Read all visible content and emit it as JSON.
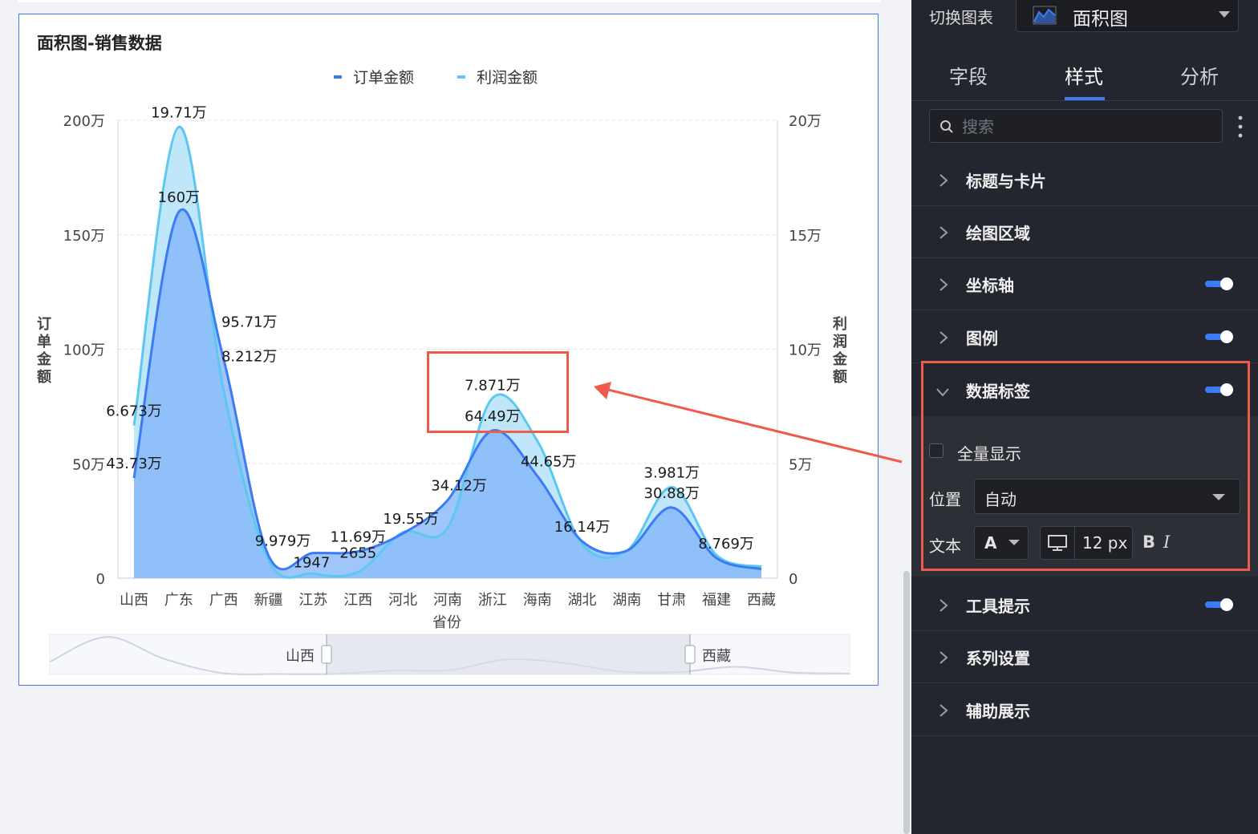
{
  "chart_card": {
    "title": "面积图-销售数据"
  },
  "chart_data": {
    "type": "area",
    "title": "面积图-销售数据",
    "xlabel": "省份",
    "ylabel_left": "订单金额",
    "ylabel_right": "利润金额",
    "categories": [
      "山西",
      "广东",
      "广西",
      "新疆",
      "江苏",
      "江西",
      "河北",
      "河南",
      "浙江",
      "海南",
      "湖北",
      "湖南",
      "甘肃",
      "福建",
      "西藏"
    ],
    "ylim_left": [
      0,
      2000000
    ],
    "ylim_right": [
      0,
      200000
    ],
    "yticks_left": [
      "0",
      "50万",
      "100万",
      "150万",
      "200万"
    ],
    "yticks_right": [
      "0",
      "5万",
      "10万",
      "15万",
      "20万"
    ],
    "grid": true,
    "legend": "top-center",
    "series": [
      {
        "name": "订单金额",
        "axis": "left",
        "color": "#3d7bf5",
        "values": [
          437300,
          1600000,
          957100,
          99790,
          110000,
          116900,
          195500,
          341200,
          644900,
          446500,
          161400,
          120000,
          308800,
          87690,
          40000
        ],
        "labels": [
          "43.73万",
          "160万",
          "95.71万",
          "9.979万",
          "",
          "11.69万",
          "19.55万",
          "34.12万",
          "64.49万",
          "44.65万",
          "16.14万",
          "",
          "30.88万",
          "8.769万",
          ""
        ]
      },
      {
        "name": "利润金额",
        "axis": "right",
        "color": "#5cc8f0",
        "values": [
          66730,
          197100,
          82120,
          8000,
          1947,
          2655,
          20000,
          22000,
          78710,
          60000,
          15000,
          12000,
          39810,
          10000,
          5000
        ],
        "labels": [
          "6.673万",
          "19.71万",
          "8.212万",
          "",
          "1947",
          "2655",
          "",
          "",
          "7.871万",
          "",
          "",
          "",
          "3.981万",
          "",
          ""
        ]
      }
    ]
  },
  "range_slider": {
    "start_label": "山西",
    "end_label": "西藏"
  },
  "panel": {
    "switch_label": "切换图表",
    "chart_type_value": "面积图",
    "tabs": [
      {
        "label": "字段"
      },
      {
        "label": "样式"
      },
      {
        "label": "分析"
      }
    ],
    "active_tab": "样式",
    "search_placeholder": "搜索",
    "sections": [
      {
        "label": "标题与卡片"
      },
      {
        "label": "绘图区域"
      },
      {
        "label": "坐标轴",
        "toggle": true
      },
      {
        "label": "图例",
        "toggle": true
      },
      {
        "label": "数据标签",
        "toggle": true
      },
      {
        "label": "工具提示",
        "toggle": true
      },
      {
        "label": "系列设置"
      },
      {
        "label": "辅助展示"
      }
    ],
    "data_labels": {
      "show_all_label": "全量显示",
      "position_label": "位置",
      "position_value": "自动",
      "text_label": "文本",
      "font_color_glyph": "A",
      "font_size_value": "12 px",
      "bold_glyph": "B",
      "italic_glyph": "I"
    }
  },
  "colors": {
    "accent": "#3d7bf5",
    "annotation_red": "#f05a4a",
    "panel_bg": "#23262e"
  }
}
